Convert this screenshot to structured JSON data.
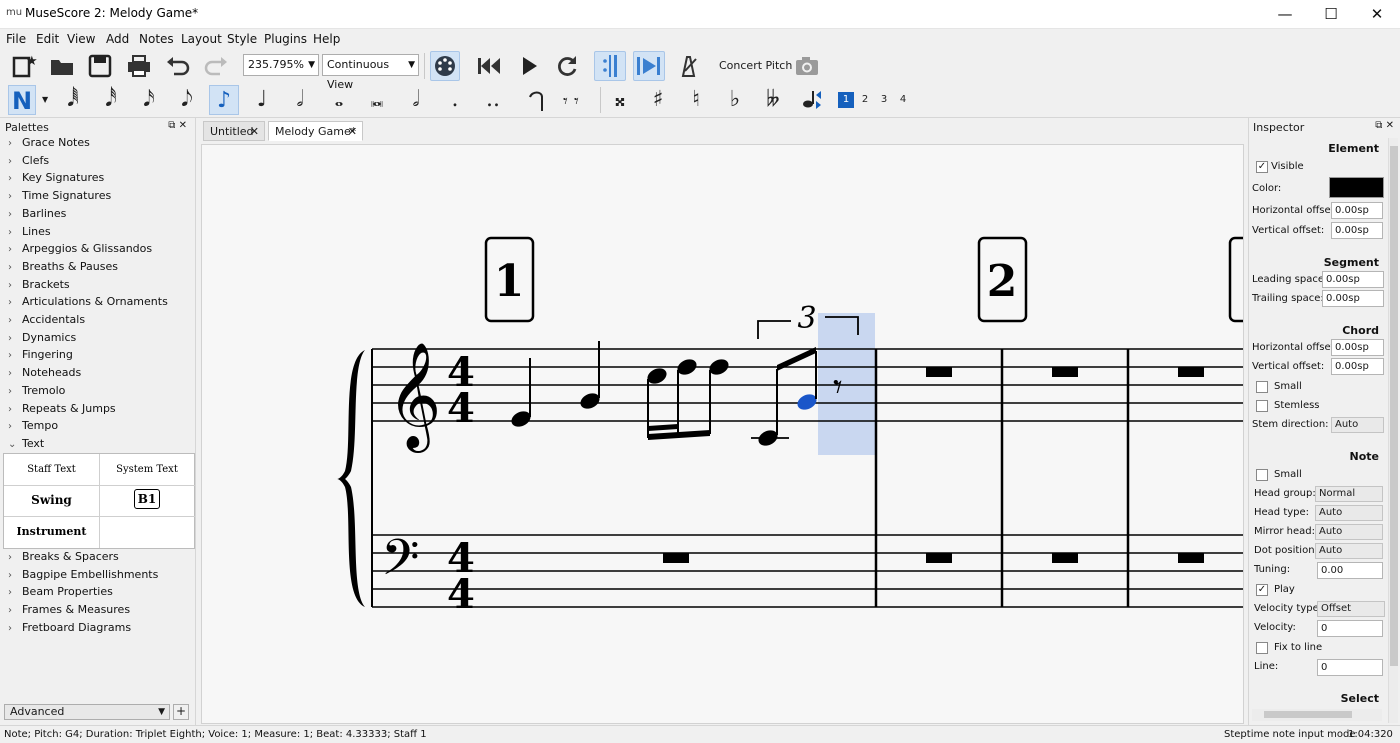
{
  "window": {
    "title": "MuseScore 2: Melody Game*",
    "app_icon": "mu",
    "controls": [
      "—",
      "☐",
      "✕"
    ]
  },
  "menu": [
    "File",
    "Edit",
    "View",
    "Add",
    "Notes",
    "Layout",
    "Style",
    "Plugins",
    "Help"
  ],
  "toolbar": {
    "zoom": "235.795%",
    "view_mode": "Continuous View",
    "concert_pitch": "Concert Pitch"
  },
  "note_input": {
    "durations": [
      "𝅘𝅥𝅱",
      "𝅘𝅥𝅰",
      "𝅘𝅥𝅯",
      "𝅘𝅥𝅮",
      "♪",
      "♩",
      "𝅗𝅥",
      "𝅝",
      "𝅜",
      "𝅗𝅥",
      ".",
      ".."
    ],
    "accidentals": [
      "𝄪",
      "♯",
      "♮",
      "♭",
      "𝄫"
    ],
    "voices": [
      "1",
      "2",
      "3",
      "4"
    ],
    "active_voice": "1"
  },
  "palettes": {
    "title": "Palettes",
    "items_top": [
      "Grace Notes",
      "Clefs",
      "Key Signatures",
      "Time Signatures",
      "Barlines",
      "Lines",
      "Arpeggios & Glissandos",
      "Breaths & Pauses",
      "Brackets",
      "Articulations & Ornaments",
      "Accidentals",
      "Dynamics",
      "Fingering",
      "Noteheads",
      "Tremolo",
      "Repeats & Jumps",
      "Tempo",
      "Text"
    ],
    "text_cells": [
      "Staff Text",
      "System Text",
      "Swing",
      "B1",
      "Instrument",
      ""
    ],
    "items_bottom": [
      "Breaks & Spacers",
      "Bagpipe Embellishments",
      "Beam Properties",
      "Frames & Measures",
      "Fretboard Diagrams"
    ],
    "mode": "Advanced",
    "add_label": "+"
  },
  "tabs": [
    {
      "label": "Untitled",
      "close": "✕"
    },
    {
      "label": "Melody Game*",
      "close": "✕"
    }
  ],
  "score": {
    "rehearsal_marks": [
      "1",
      "2"
    ],
    "tuplet": "3",
    "time_signature": [
      "4",
      "4"
    ]
  },
  "inspector": {
    "title": "Inspector",
    "element": {
      "section": "Element",
      "visible_label": "Visible",
      "visible": true,
      "color_label": "Color:",
      "color": "#000000",
      "h_offset_label": "Horizontal offset:",
      "h_offset": "0.00sp",
      "v_offset_label": "Vertical offset:",
      "v_offset": "0.00sp"
    },
    "segment": {
      "section": "Segment",
      "leading_label": "Leading space:",
      "leading": "0.00sp",
      "trailing_label": "Trailing space:",
      "trailing": "0.00sp"
    },
    "chord": {
      "section": "Chord",
      "h_offset_label": "Horizontal offset:",
      "h_offset": "0.00sp",
      "v_offset_label": "Vertical offset:",
      "v_offset": "0.00sp",
      "small_label": "Small",
      "stemless_label": "Stemless",
      "stem_dir_label": "Stem direction:",
      "stem_dir": "Auto"
    },
    "note": {
      "section": "Note",
      "small_label": "Small",
      "head_group_label": "Head group:",
      "head_group": "Normal",
      "head_type_label": "Head type:",
      "head_type": "Auto",
      "mirror_label": "Mirror head:",
      "mirror": "Auto",
      "dot_label": "Dot position:",
      "dot": "Auto",
      "tuning_label": "Tuning:",
      "tuning": "0.00",
      "play_label": "Play",
      "velocity_type_label": "Velocity type:",
      "velocity_type": "Offset",
      "velocity_label": "Velocity:",
      "velocity": "0",
      "fix_label": "Fix to line",
      "line_label": "Line:",
      "line": "0"
    },
    "select": "Select"
  },
  "status": {
    "left": "Note; Pitch: G4; Duration: Triplet Eighth; Voice: 1;  Measure: 1; Beat: 4.33333; Staff 1",
    "mode": "Steptime note input mode",
    "time": "1:04:320"
  },
  "colors": {
    "selection": "#c9d7f0",
    "accent": "#1560bd",
    "selected_note": "#1a56c9"
  }
}
